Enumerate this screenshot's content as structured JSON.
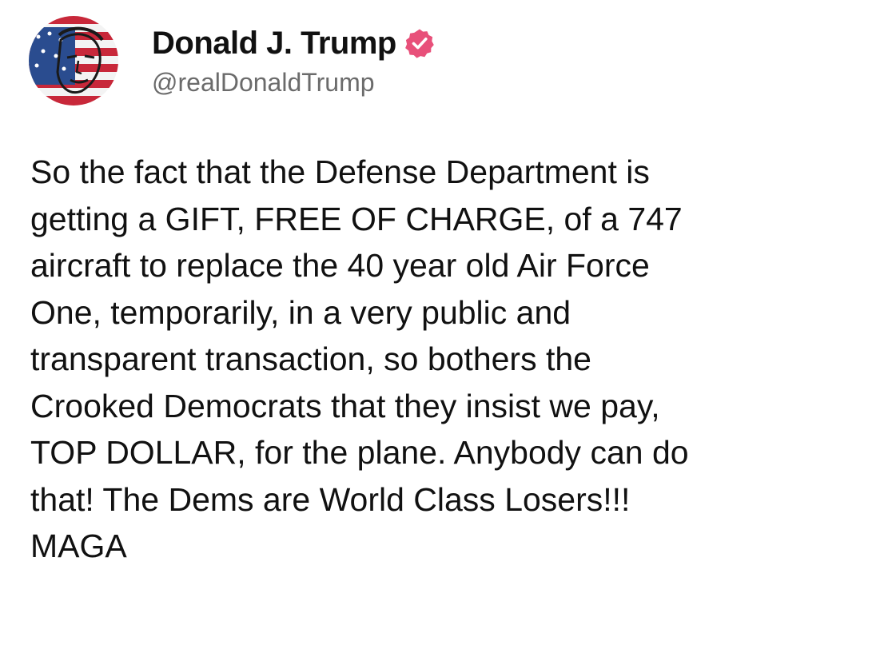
{
  "author": {
    "display_name": "Donald J. Trump",
    "handle": "@realDonaldTrump",
    "verified": true,
    "avatar_icon": "flag-portrait-avatar",
    "verified_icon": "verified-badge-icon"
  },
  "post": {
    "text": "So the fact that the Defense Department is\ngetting a GIFT, FREE OF CHARGE, of a 747\naircraft to replace the 40 year old Air Force\nOne, temporarily, in a very public and\ntransparent transaction, so bothers the\nCrooked Democrats that they insist we pay,\nTOP DOLLAR, for the plane. Anybody can do\nthat! The Dems are World Class Losers!!!\nMAGA"
  },
  "colors": {
    "verified_badge": "#e8507a",
    "text": "#111111",
    "handle": "#6b6b6b",
    "background": "#ffffff"
  }
}
